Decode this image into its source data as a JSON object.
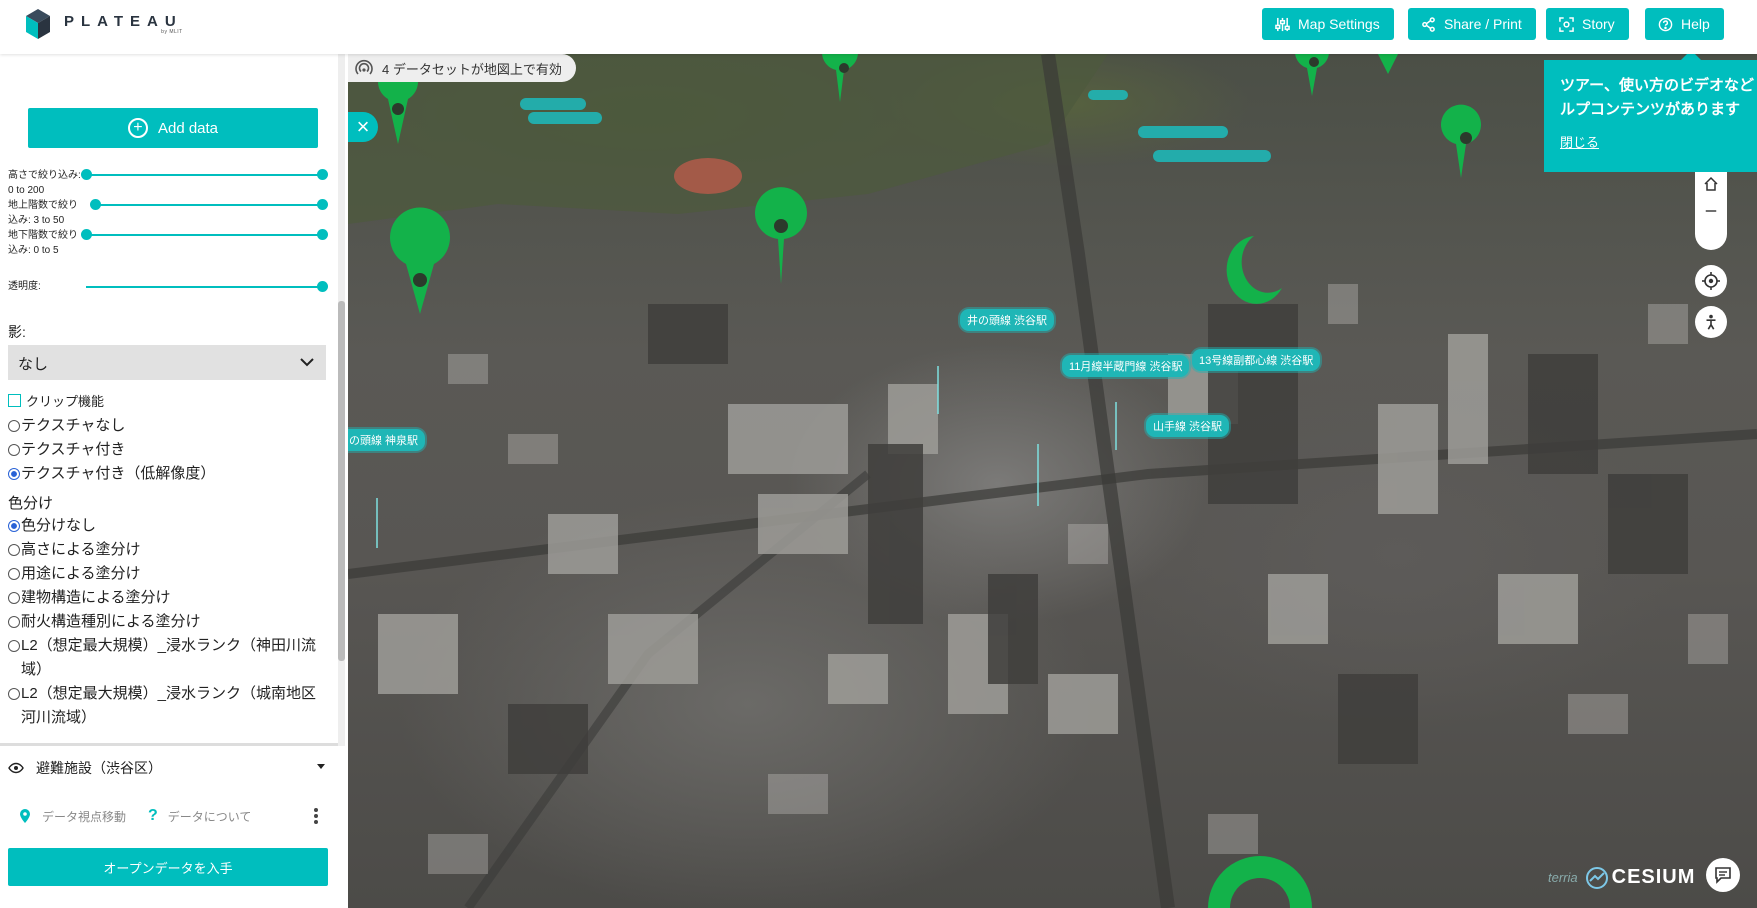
{
  "header": {
    "logo_word": "PLATEAU",
    "logo_sub": "by MLIT",
    "buttons": {
      "map_settings": "Map Settings",
      "share_print": "Share / Print",
      "story": "Story",
      "help": "Help"
    }
  },
  "panel": {
    "add_data": "Add data",
    "sliders": [
      {
        "label": "高さで絞り込み: 0 to 200"
      },
      {
        "label": "地上階数で絞り込み: 3 to 50"
      },
      {
        "label": "地下階数で絞り込み: 0 to 5"
      },
      {
        "label": "透明度:"
      }
    ],
    "shadow_label": "影:",
    "shadow_value": "なし",
    "clip_label": "クリップ機能",
    "texture_options": [
      {
        "label": "テクスチャなし",
        "selected": false
      },
      {
        "label": "テクスチャ付き",
        "selected": false
      },
      {
        "label": "テクスチャ付き（低解像度）",
        "selected": true
      }
    ],
    "color_section_title": "色分け",
    "color_options": [
      {
        "label": "色分けなし",
        "selected": true
      },
      {
        "label": "高さによる塗分け",
        "selected": false
      },
      {
        "label": "用途による塗分け",
        "selected": false
      },
      {
        "label": "建物構造による塗分け",
        "selected": false
      },
      {
        "label": "耐火構造種別による塗分け",
        "selected": false
      },
      {
        "label": "L2（想定最大規模）_浸水ランク（神田川流域）",
        "selected": false
      },
      {
        "label": "L2（想定最大規模）_浸水ランク（城南地区河川流域）",
        "selected": false
      }
    ],
    "layer_name": "避難施設（渋谷区）",
    "action_zoom": "データ視点移動",
    "action_about": "データについて",
    "open_data": "オープンデータを入手"
  },
  "map": {
    "dataset_status": "4 データセットが地図上で有効",
    "station_labels": [
      "井の頭線 渋谷駅",
      "11月線半蔵門線 渋谷駅",
      "13号線副都心線 渋谷駅",
      "山手線 渋谷駅",
      "の頭線 神泉駅"
    ],
    "help_popup": {
      "message_line1": "ツアー、使い方のビデオなど",
      "message_line2": "ルプコンテンツがあります",
      "close": "閉じる"
    },
    "credits": {
      "terria": "terria",
      "cesium": "CESIUM"
    }
  },
  "colors": {
    "accent": "#00bebe",
    "pin_green": "#13b24a"
  }
}
